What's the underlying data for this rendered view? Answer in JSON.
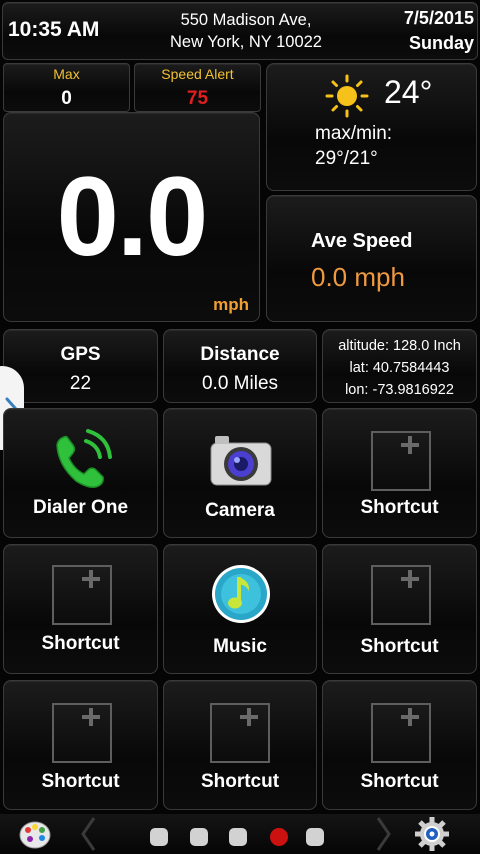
{
  "status": {
    "time": "10:35 AM",
    "address_line1": "550 Madison Ave,",
    "address_line2": "New York, NY 10022",
    "date": "7/5/2015",
    "day": "Sunday"
  },
  "speed": {
    "max_label": "Max",
    "max_value": "0",
    "alert_label": "Speed Alert",
    "alert_value": "75",
    "current": "0.0",
    "unit": "mph"
  },
  "weather": {
    "icon": "sun-icon",
    "temp": "24°",
    "maxmin_label": "max/min:",
    "maxmin_value": "29°/21°"
  },
  "ave_speed": {
    "label": "Ave Speed",
    "value": "0.0 mph"
  },
  "gps": {
    "label": "GPS",
    "value": "22"
  },
  "distance": {
    "label": "Distance",
    "value": "0.0 Miles"
  },
  "location": {
    "altitude": "altitude: 128.0 Inch",
    "lat": "lat: 40.7584443",
    "lon": "lon: -73.9816922"
  },
  "tiles": [
    {
      "label": "Dialer One",
      "icon": "phone-icon"
    },
    {
      "label": "Camera",
      "icon": "camera-icon"
    },
    {
      "label": "Shortcut",
      "icon": "add-shortcut-icon"
    },
    {
      "label": "Shortcut",
      "icon": "add-shortcut-icon"
    },
    {
      "label": "Music",
      "icon": "music-note-icon"
    },
    {
      "label": "Shortcut",
      "icon": "add-shortcut-icon"
    },
    {
      "label": "Shortcut",
      "icon": "add-shortcut-icon"
    },
    {
      "label": "Shortcut",
      "icon": "add-shortcut-icon"
    },
    {
      "label": "Shortcut",
      "icon": "add-shortcut-icon"
    }
  ],
  "pager": {
    "pages": 5,
    "active_index": 3
  },
  "colors": {
    "max_label": "#f2c032",
    "alert_label": "#f2c032",
    "alert_value": "#e02020",
    "unit": "#f0a030",
    "ave_speed_value": "#f09a40",
    "active_page": "#cc1111",
    "inactive_page": "#d2d2d2"
  }
}
